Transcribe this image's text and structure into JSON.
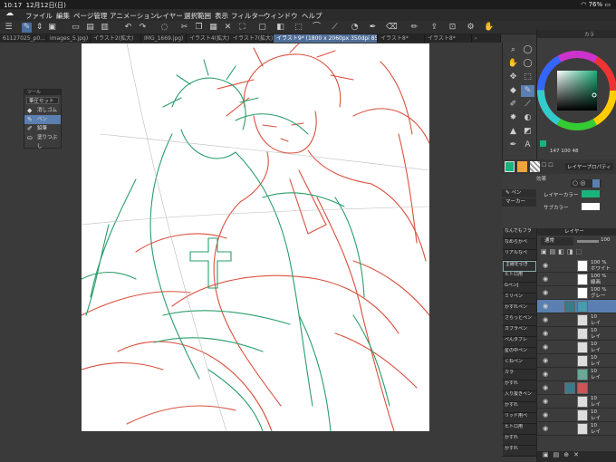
{
  "status": {
    "time": "10:17",
    "date": "12月12日(日)",
    "battery": "76%"
  },
  "menu": [
    "ファイル",
    "編集",
    "ページ管理",
    "アニメーション",
    "レイヤー",
    "選択範囲",
    "表示",
    "フィルター",
    "ウィンドウ",
    "ヘルプ"
  ],
  "tabs": [
    "61127025_p0...",
    "images_5.jpg)",
    "イラスト2(拡大)",
    "IMG_1669.jpg)",
    "イラスト4(拡大)",
    "イラスト7(拡大)",
    "イラスト9* (1800 x 2060px 350dpi 85.6%)",
    "イラスト8*",
    "イラスト8*"
  ],
  "subtool_panel": {
    "title": "ツール",
    "preset": "筆圧セット",
    "items": [
      "消しゴム",
      "ペン",
      "鉛筆",
      "塗りつぶし"
    ]
  },
  "color_panel": {
    "tab": "カラ",
    "values": [
      "147",
      "100",
      "48"
    ]
  },
  "property_panel": {
    "title": "レイヤープロパティ",
    "subtitle": "効果",
    "main_color_label": "レイヤーカラー",
    "sub_color_label": "サブカラー",
    "accent_color": "#19b47a"
  },
  "brush_panel": {
    "tab_label": "ペン",
    "items": [
      "マーカー",
      "なんでもブラ",
      "なめらかペ",
      "リアルなペ",
      "主線を引き",
      "ヒトロ用",
      "GペンJ",
      "ミリペン",
      "かすれペン",
      "さらっとペン",
      "カブラペン",
      "ぺんタブレ",
      "星の中ペン",
      "くねペン",
      "カラ",
      "かすれ",
      "入り抜きペン",
      "かすれ",
      "リッド用ペ",
      "ヒトロ用",
      "かすれ",
      "かすれ"
    ]
  },
  "layer_panel": {
    "tab": "レイヤー",
    "blend": "通常",
    "opacity": "100",
    "layers": [
      {
        "line1": "100 %",
        "line2": "ホワイト"
      },
      {
        "line1": "100 %",
        "line2": "線画"
      },
      {
        "line1": "100 %",
        "line2": "グレー"
      },
      {
        "line1": "",
        "line2": ""
      },
      {
        "line1": "10",
        "line2": "レイ"
      },
      {
        "line1": "10",
        "line2": "レイ"
      },
      {
        "line1": "10",
        "line2": "レイ"
      },
      {
        "line1": "10",
        "line2": "レイ"
      },
      {
        "line1": "10",
        "line2": "レイ"
      },
      {
        "line1": "",
        "line2": ""
      },
      {
        "line1": "10",
        "line2": "レイ"
      },
      {
        "line1": "10",
        "line2": "レイ"
      },
      {
        "line1": "10",
        "line2": "レイ"
      }
    ]
  },
  "colors": {
    "red_line": "#d9513f",
    "green_line": "#2a9e6a",
    "selection": "#5a7fb0"
  }
}
